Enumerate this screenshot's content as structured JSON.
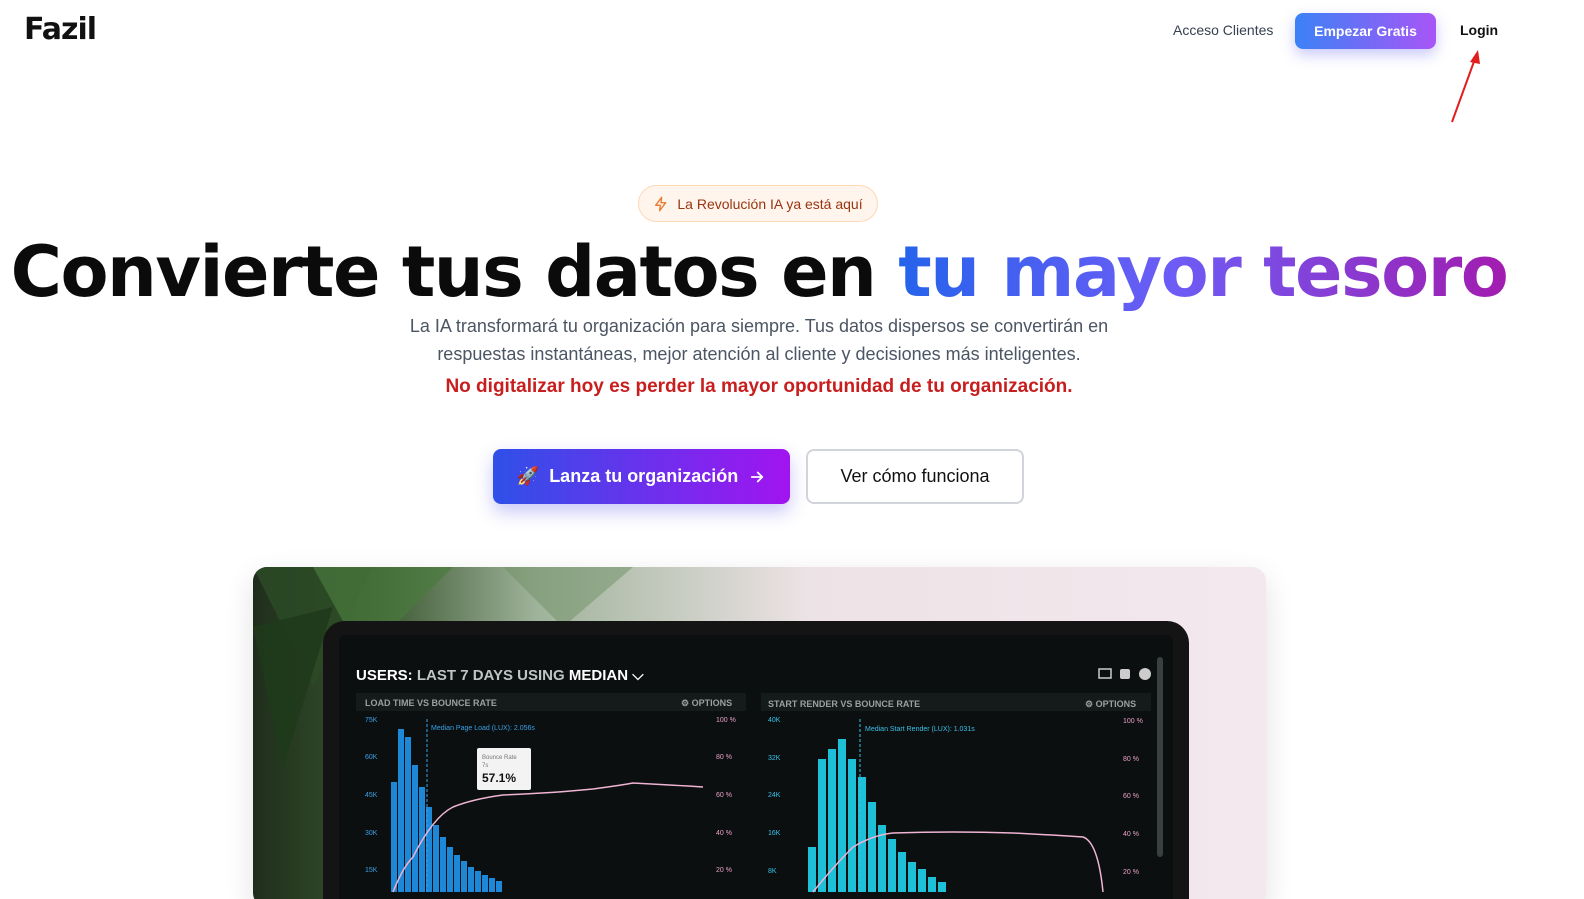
{
  "brand": {
    "logo": "Fazil"
  },
  "nav": {
    "acceso_clientes": "Acceso Clientes",
    "empezar_gratis": "Empezar Gratis",
    "login": "Login"
  },
  "badge": {
    "label": "La Revolución IA ya está aquí",
    "icon": "lightning-icon"
  },
  "hero": {
    "title_plain": "Convierte tus datos en",
    "title_highlight": "tu mayor tesoro",
    "subtitle": "La IA transformará tu organización para siempre. Tus datos dispersos se convertirán en respuestas instantáneas, mejor atención al cliente y decisiones más inteligentes.",
    "alert": "No digitalizar hoy es perder la mayor oportunidad de tu organización.",
    "cta_primary": "Lanza tu organización",
    "cta_primary_icon": "🚀",
    "cta_secondary": "Ver cómo funciona"
  },
  "dashboard": {
    "header_prefix": "USERS:",
    "header_range": "LAST 7 DAYS",
    "header_mid": "USING",
    "header_stat": "MEDIAN",
    "left_panel": {
      "title": "LOAD TIME VS BOUNCE RATE",
      "options": "OPTIONS",
      "y_left": [
        "75K",
        "60K",
        "45K",
        "30K",
        "15K"
      ],
      "y_right": [
        "100 %",
        "80 %",
        "60 %",
        "40 %",
        "20 %"
      ],
      "marker": "Median Page Load (LUX): 2.056s",
      "tooltip_label": "Bounce Rate",
      "tooltip_sub": "7s",
      "tooltip_value": "57.1%"
    },
    "right_panel": {
      "title": "START RENDER VS BOUNCE RATE",
      "options": "OPTIONS",
      "y_left": [
        "40K",
        "32K",
        "24K",
        "16K",
        "8K"
      ],
      "y_right": [
        "100 %",
        "80 %",
        "60 %",
        "40 %",
        "20 %"
      ],
      "marker": "Median Start Render (LUX): 1.031s"
    }
  },
  "colors": {
    "primary_start": "#2f50e8",
    "primary_end": "#a114f0",
    "alert": "#c81e1e",
    "chart_bar_left": "#1e88d8",
    "chart_bar_right": "#1ec0d8"
  }
}
